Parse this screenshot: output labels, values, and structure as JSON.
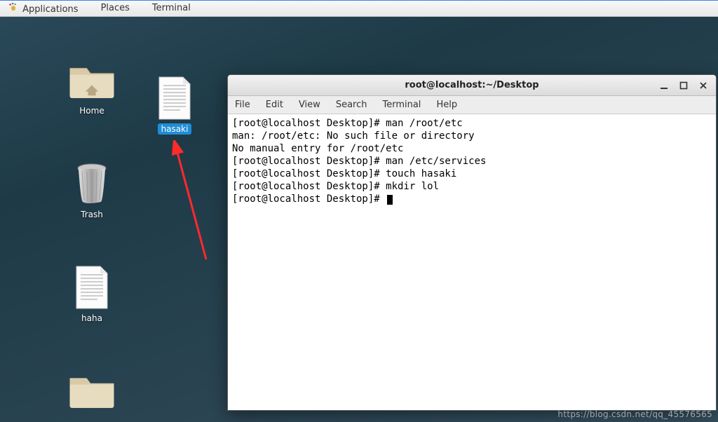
{
  "panel": {
    "applications": "Applications",
    "places": "Places",
    "terminal": "Terminal"
  },
  "desktop": {
    "home": "Home",
    "trash": "Trash",
    "haha": "haha",
    "hasaki": "hasaki"
  },
  "window": {
    "title": "root@localhost:~/Desktop",
    "menu": {
      "file": "File",
      "edit": "Edit",
      "view": "View",
      "search": "Search",
      "terminal": "Terminal",
      "help": "Help"
    }
  },
  "terminal": {
    "l1": "[root@localhost Desktop]# man /root/etc",
    "l2": "man: /root/etc: No such file or directory",
    "l3": "No manual entry for /root/etc",
    "l4": "[root@localhost Desktop]# man /etc/services",
    "l5": "[root@localhost Desktop]# touch hasaki",
    "l6": "[root@localhost Desktop]# mkdir lol",
    "l7": "[root@localhost Desktop]# "
  },
  "watermark": "https://blog.csdn.net/qq_45576565"
}
